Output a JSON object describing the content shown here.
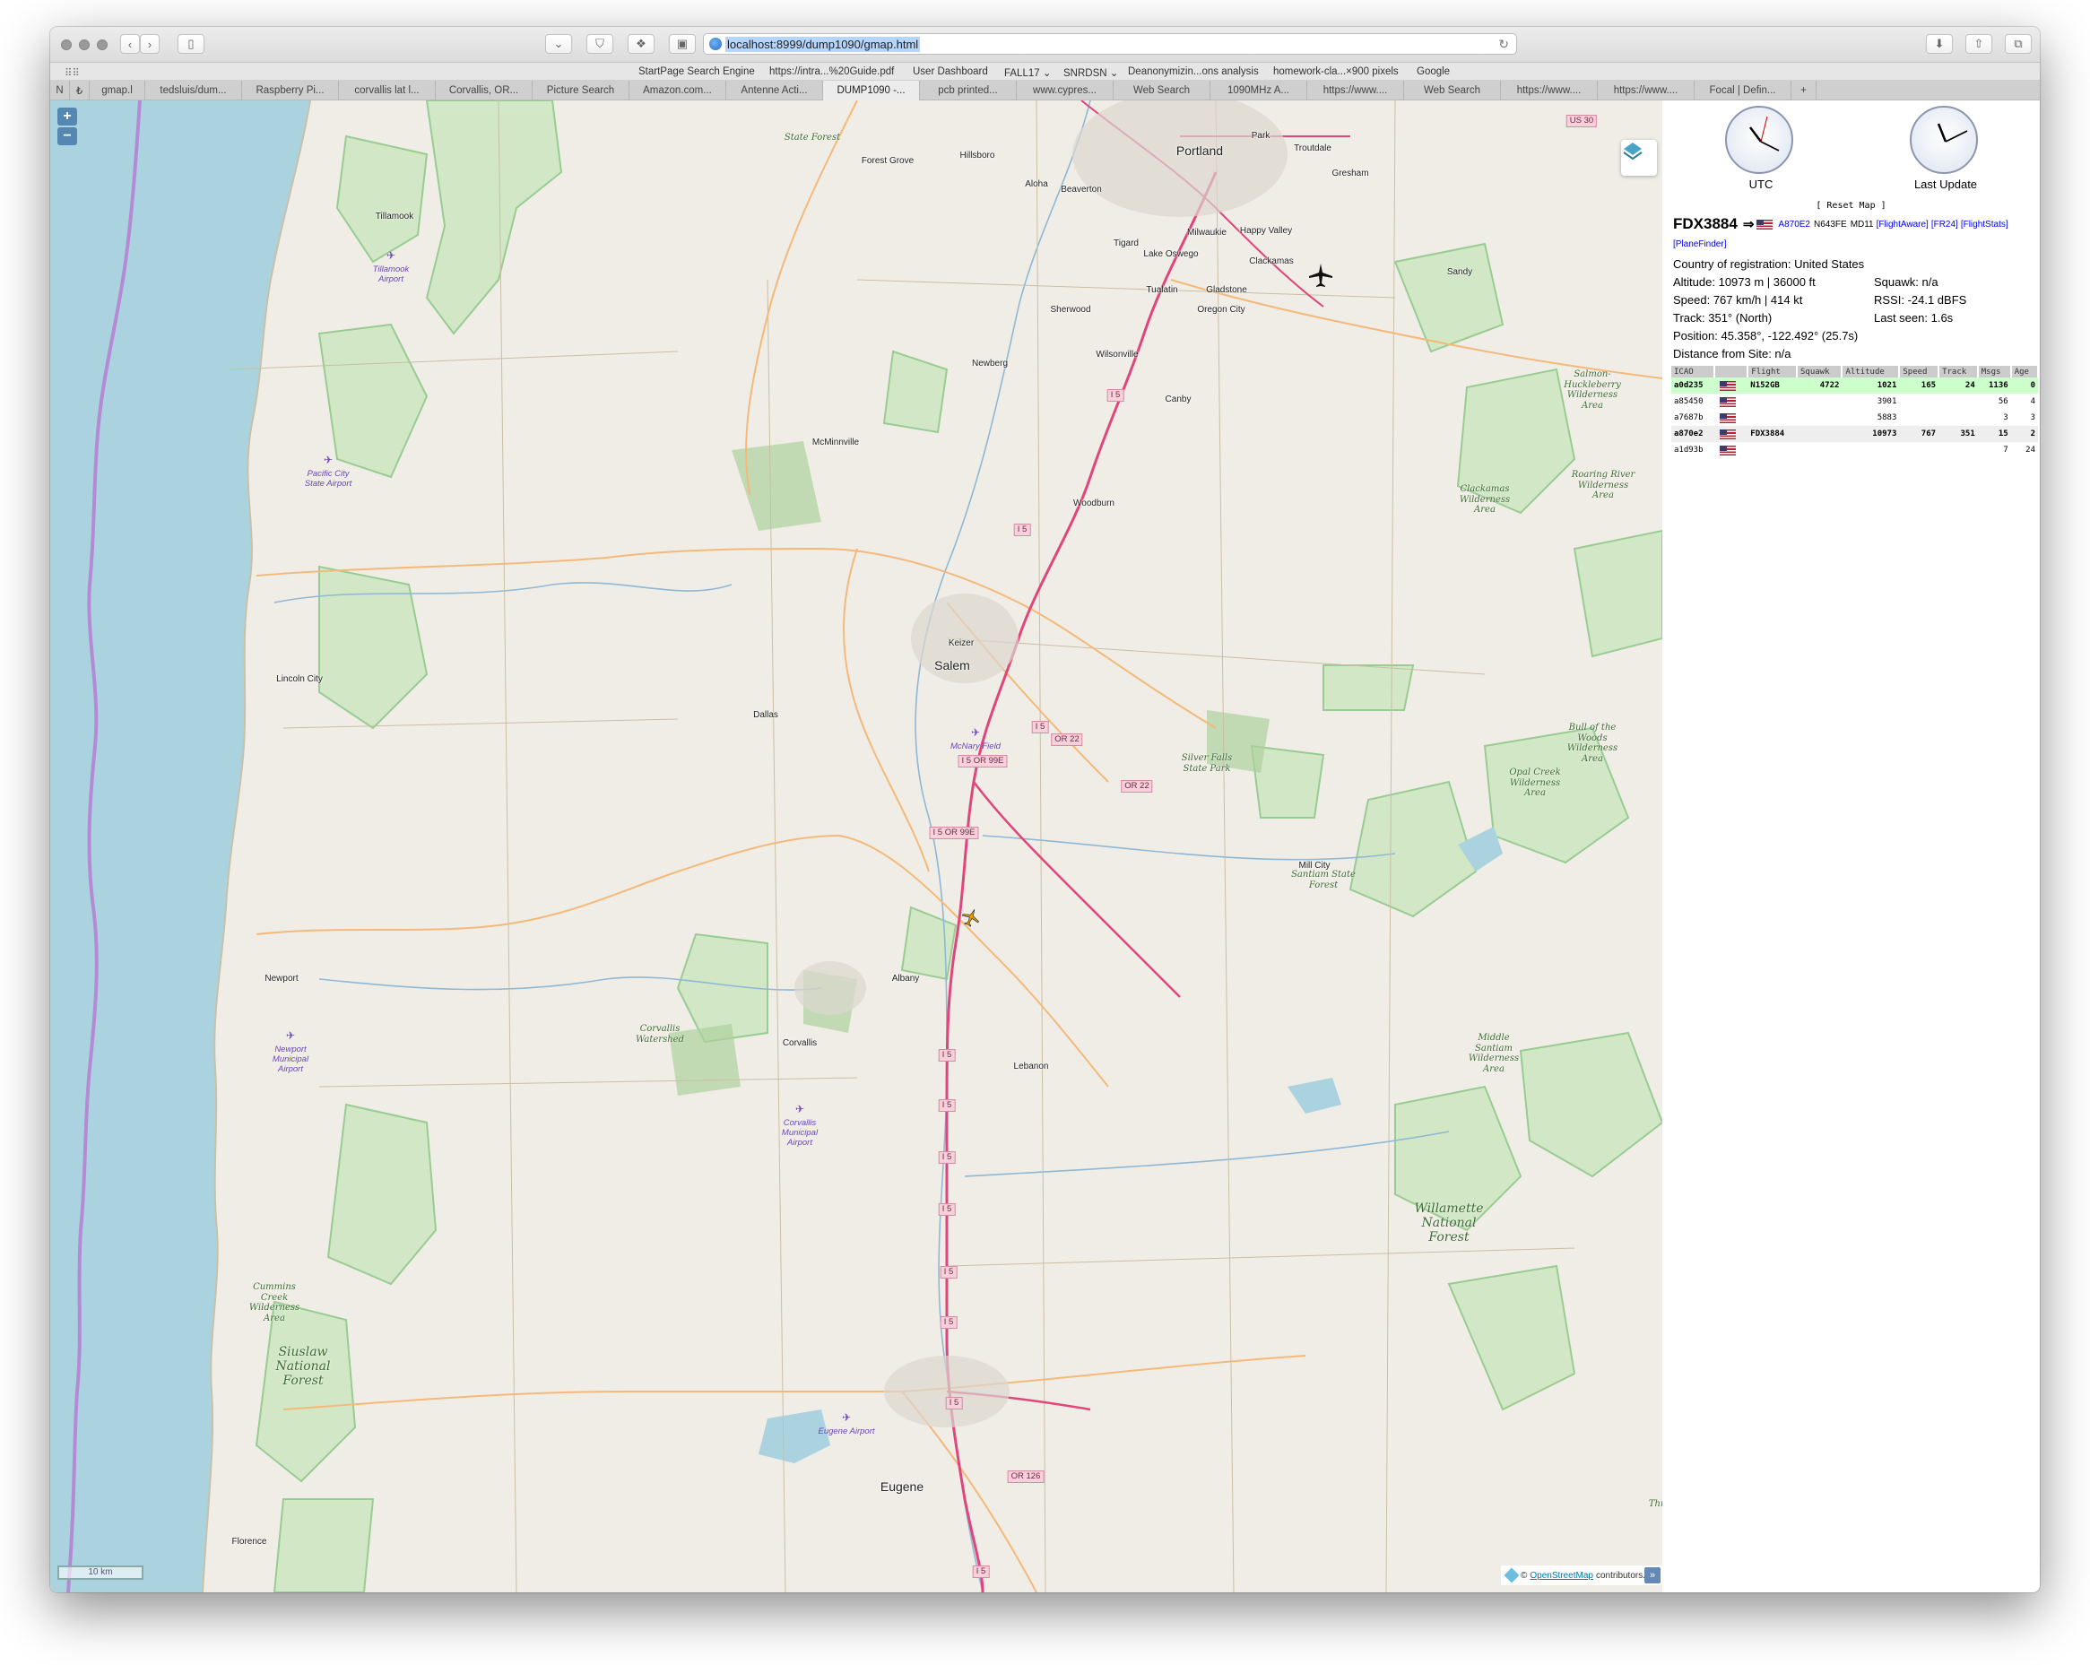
{
  "browser": {
    "url": "localhost:8999/dump1090/gmap.html",
    "bookmarks": [
      "StartPage Search Engine",
      "https://intra...%20Guide.pdf",
      "User Dashboard",
      "FALL17 ⌄",
      "SNRDSN ⌄",
      "Deanonymizin...ons analysis",
      "homework-cla...×900 pixels",
      "Google"
    ],
    "tabs": [
      "N",
      "₺",
      "gmap.l",
      "tedsluis/dum...",
      "Raspberry Pi...",
      "corvallis lat l...",
      "Corvallis, OR...",
      "Picture Search",
      "Amazon.com...",
      "Antenne Acti...",
      "DUMP1090 -...",
      "pcb printed...",
      "www.cypres...",
      "Web Search",
      "1090MHz A...",
      "https://www....",
      "Web Search",
      "https://www....",
      "https://www....",
      "Focal | Defin...",
      "+"
    ],
    "active_tab_index": 10
  },
  "map": {
    "zoom_in": "+",
    "zoom_out": "−",
    "scale_label": "10 km",
    "attribution_prefix": "©",
    "attribution_link": "OpenStreetMap",
    "attribution_suffix": "contributors.",
    "attribution_toggle": "»",
    "places": [
      {
        "name": "Portland",
        "cls": "city"
      },
      {
        "name": "Gresham",
        "cls": "town"
      },
      {
        "name": "Troutdale",
        "cls": "town"
      },
      {
        "name": "Hillsboro",
        "cls": "town"
      },
      {
        "name": "Forest Grove",
        "cls": "town"
      },
      {
        "name": "Aloha",
        "cls": "town"
      },
      {
        "name": "Beaverton",
        "cls": "town"
      },
      {
        "name": "Tigard",
        "cls": "town"
      },
      {
        "name": "Milwaukie",
        "cls": "town"
      },
      {
        "name": "Happy Valley",
        "cls": "town"
      },
      {
        "name": "Lake Oswego",
        "cls": "town"
      },
      {
        "name": "Clackamas",
        "cls": "town"
      },
      {
        "name": "Tualatin",
        "cls": "town"
      },
      {
        "name": "Gladstone",
        "cls": "town"
      },
      {
        "name": "Sandy",
        "cls": "town"
      },
      {
        "name": "Sherwood",
        "cls": "town"
      },
      {
        "name": "Oregon City",
        "cls": "town"
      },
      {
        "name": "Wilsonville",
        "cls": "town"
      },
      {
        "name": "Newberg",
        "cls": "town"
      },
      {
        "name": "Canby",
        "cls": "town"
      },
      {
        "name": "Tillamook",
        "cls": "town"
      },
      {
        "name": "McMinnville",
        "cls": "town"
      },
      {
        "name": "Woodburn",
        "cls": "town"
      },
      {
        "name": "Keizer",
        "cls": "town"
      },
      {
        "name": "Salem",
        "cls": "city"
      },
      {
        "name": "Dallas",
        "cls": "town"
      },
      {
        "name": "Lincoln City",
        "cls": "town"
      },
      {
        "name": "Mill City",
        "cls": "town"
      },
      {
        "name": "Newport",
        "cls": "town"
      },
      {
        "name": "Albany",
        "cls": "town"
      },
      {
        "name": "Corvallis",
        "cls": "town"
      },
      {
        "name": "Lebanon",
        "cls": "town"
      },
      {
        "name": "Eugene",
        "cls": "city"
      },
      {
        "name": "Florence",
        "cls": "town"
      },
      {
        "name": "Park",
        "cls": "town"
      }
    ],
    "areas": [
      {
        "name": "Salmon-Huckleberry Wilderness Area"
      },
      {
        "name": "Roaring River Wilderness Area"
      },
      {
        "name": "Clackamas Wilderness Area"
      },
      {
        "name": "Bull of the Woods Wilderness Area"
      },
      {
        "name": "Opal Creek Wilderness Area"
      },
      {
        "name": "Santiam State Forest"
      },
      {
        "name": "Silver Falls State Park"
      },
      {
        "name": "Middle Santiam Wilderness Area"
      },
      {
        "name": "Willamette National Forest"
      },
      {
        "name": "Siuslaw National Forest"
      },
      {
        "name": "Cummins Creek Wilderness Area"
      },
      {
        "name": "Corvallis Watershed"
      },
      {
        "name": "Thr Wi"
      },
      {
        "name": "State Forest"
      }
    ],
    "airports": [
      {
        "name": "Tillamook Airport"
      },
      {
        "name": "Pacific City State Airport"
      },
      {
        "name": "McNary Field"
      },
      {
        "name": "Newport Municipal Airport"
      },
      {
        "name": "Corvallis Municipal Airport"
      },
      {
        "name": "Eugene Airport"
      }
    ],
    "shields": [
      "I 5",
      "I 5",
      "I 5",
      "OR 22",
      "OR 22",
      "I 5 OR 99E",
      "I 5 OR 99E",
      "I 5",
      "I 5",
      "I 5",
      "I 5",
      "I 5",
      "I 5",
      "I 5",
      "OR 126",
      "I 5",
      "US 30"
    ],
    "colors": {
      "water": "#aad3df",
      "land": "#f2efe9",
      "forest_outline": "#8fc98a",
      "forest_fill": "#c8e6bf",
      "interstate": "#e0457b",
      "primary": "#f4b97a",
      "coast_border": "#b58ad4"
    }
  },
  "panel": {
    "clocks": [
      {
        "label": "UTC"
      },
      {
        "label": "Last Update"
      }
    ],
    "reset_map": "[ Reset Map ]",
    "selected": {
      "callsign": "FDX3884",
      "arrow": "⇒",
      "icao_link": "A870E2",
      "reg": "N643FE",
      "type": "MD11",
      "links": [
        "[FlightAware]",
        "[FR24]",
        "[FlightStats]"
      ],
      "planefinder": "[PlaneFinder]",
      "country": "Country of registration: United States",
      "altitude": "Altitude: 10973 m | 36000 ft",
      "squawk": "Squawk: n/a",
      "speed": "Speed: 767 km/h | 414 kt",
      "rssi": "RSSI: -24.1 dBFS",
      "track": "Track: 351° (North)",
      "last_seen": "Last seen: 1.6s",
      "position": "Position: 45.358°, -122.492° (25.7s)",
      "distance": "Distance from Site: n/a"
    },
    "table": {
      "headers": [
        "ICAO",
        "",
        "Flight",
        "Squawk",
        "Altitude",
        "Speed",
        "Track",
        "Msgs",
        "Age"
      ],
      "rows": [
        {
          "icao": "a0d235",
          "flight": "N152GB",
          "squawk": "4722",
          "altitude": "1021",
          "speed": "165",
          "track": "24",
          "msgs": "1136",
          "age": "0",
          "style": "sel"
        },
        {
          "icao": "a85450",
          "flight": "",
          "squawk": "",
          "altitude": "3901",
          "speed": "",
          "track": "",
          "msgs": "56",
          "age": "4",
          "style": ""
        },
        {
          "icao": "a7687b",
          "flight": "",
          "squawk": "",
          "altitude": "5883",
          "speed": "",
          "track": "",
          "msgs": "3",
          "age": "3",
          "style": ""
        },
        {
          "icao": "a870e2",
          "flight": "FDX3884",
          "squawk": "",
          "altitude": "10973",
          "speed": "767",
          "track": "351",
          "msgs": "15",
          "age": "2",
          "style": "hl"
        },
        {
          "icao": "a1d93b",
          "flight": "",
          "squawk": "",
          "altitude": "",
          "speed": "",
          "track": "",
          "msgs": "7",
          "age": "24",
          "style": ""
        }
      ]
    }
  }
}
